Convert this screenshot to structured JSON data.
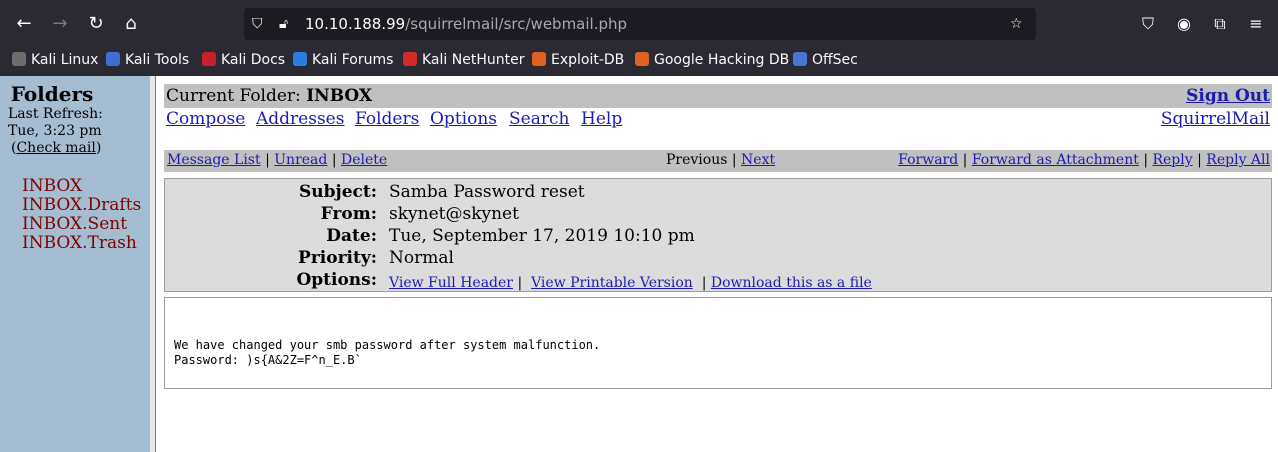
{
  "browser": {
    "url_host": "10.10.188.99",
    "url_path": "/squirrelmail/src/webmail.php",
    "bookmarks": [
      {
        "label": "Kali Linux",
        "icon": "kali-dragon-icon",
        "color": "#6e6e6e"
      },
      {
        "label": "Kali Tools",
        "icon": "kali-tools-icon",
        "color": "#3d6fd6"
      },
      {
        "label": "Kali Docs",
        "icon": "kali-docs-icon",
        "color": "#c8202f"
      },
      {
        "label": "Kali Forums",
        "icon": "kali-forums-icon",
        "color": "#2a7ee0"
      },
      {
        "label": "Kali NetHunter",
        "icon": "nethunter-icon",
        "color": "#d32b2b"
      },
      {
        "label": "Exploit-DB",
        "icon": "exploitdb-icon",
        "color": "#e0621f"
      },
      {
        "label": "Google Hacking DB",
        "icon": "ghdb-icon",
        "color": "#e0621f"
      },
      {
        "label": "OffSec",
        "icon": "offsec-icon",
        "color": "#4a74d4"
      }
    ]
  },
  "sidebar": {
    "title": "Folders",
    "last_refresh_label": "Last Refresh:",
    "last_refresh_time": "Tue, 3:23 pm",
    "check_mail_open": "(",
    "check_mail": "Check mail",
    "check_mail_close": ")",
    "folders": [
      "INBOX",
      "INBOX.Drafts",
      "INBOX.Sent",
      "INBOX.Trash"
    ]
  },
  "topbar": {
    "current_folder_label": "Current Folder: ",
    "current_folder": "INBOX",
    "sign_out": "Sign Out"
  },
  "menu": {
    "items": [
      "Compose",
      "Addresses",
      "Folders",
      "Options",
      "Search",
      "Help"
    ],
    "brand": "SquirrelMail"
  },
  "msgnav": {
    "message_list": "Message List",
    "unread": "Unread",
    "delete": "Delete",
    "previous": "Previous",
    "next": "Next",
    "forward": "Forward",
    "forward_attachment": "Forward as Attachment",
    "reply": "Reply",
    "reply_all": "Reply All",
    "sep": "|"
  },
  "message": {
    "subject_label": "Subject:",
    "subject": "Samba Password reset",
    "from_label": "From:",
    "from": "skynet@skynet",
    "date_label": "Date:",
    "date": "Tue, September 17, 2019 10:10 pm",
    "priority_label": "Priority:",
    "priority": "Normal",
    "options_label": "Options:",
    "view_full_header": "View Full Header",
    "view_printable": "View Printable Version",
    "download": "Download this as a file",
    "body_lines": [
      "We have changed your smb password after system malfunction.",
      "Password: )s{A&2Z=F^n_E.B`"
    ]
  }
}
